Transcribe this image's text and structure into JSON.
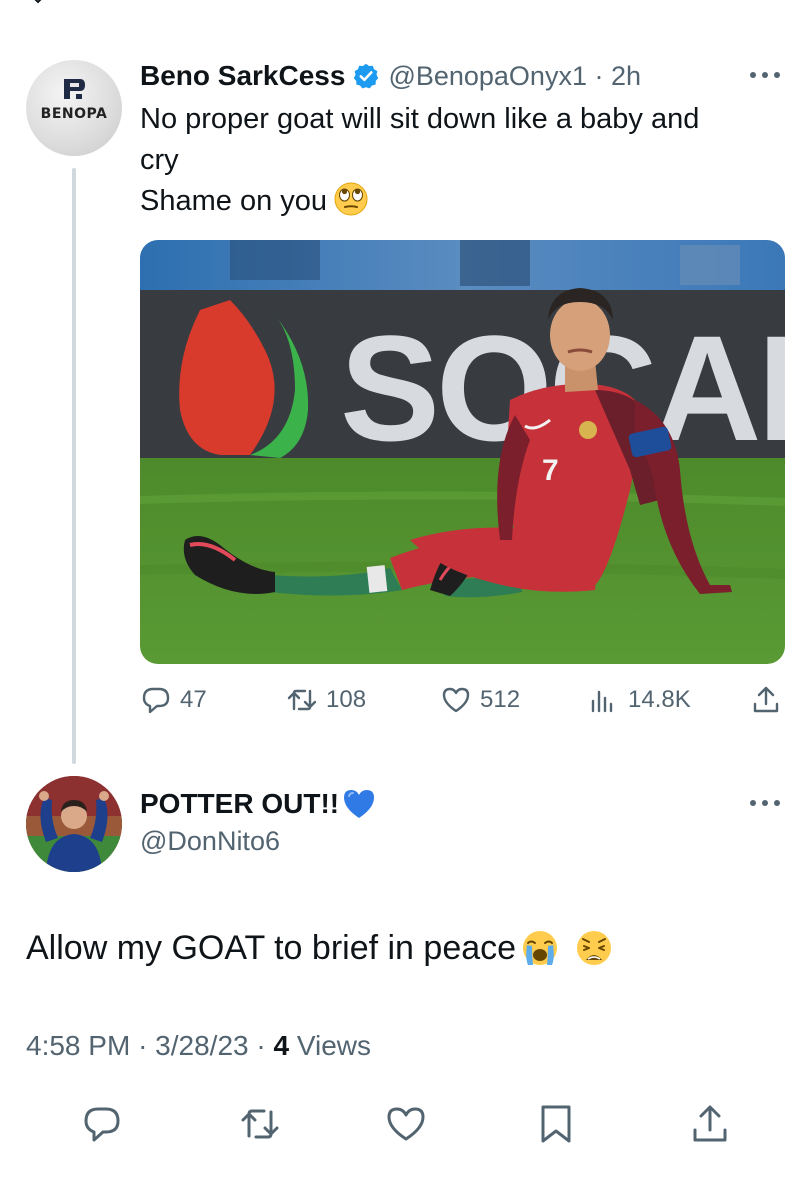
{
  "tweet": {
    "author": {
      "name": "Beno SarkCess",
      "handle": "@BenopaOnyx1",
      "time": "2h",
      "avatar_text": "BENOPA",
      "verified": true
    },
    "text_lines": [
      "No proper goat will sit down like a baby and",
      "cry",
      "Shame on you"
    ],
    "text_emoji": "face-with-rolling-eyes",
    "photo": {
      "banner_text": "SOCAR",
      "jersey_number": "7"
    },
    "stats": {
      "replies": "47",
      "retweets": "108",
      "likes": "512",
      "views": "14.8K"
    }
  },
  "reply": {
    "author": {
      "name": "POTTER OUT!!",
      "name_emoji": "blue-heart",
      "handle": "@DonNito6"
    },
    "text": "Allow my GOAT to brief in peace",
    "text_emojis": [
      "loudly-crying-face",
      "weary-face"
    ],
    "meta": {
      "time": "4:58 PM",
      "date": "3/28/23",
      "views_count": "4",
      "views_label": "Views",
      "separator": "·"
    }
  },
  "colors": {
    "text": "#0f1419",
    "secondary": "#536471",
    "verified": "#1d9bf0",
    "thread_line": "#cfd9de",
    "blue_heart": "#2f7ae5"
  }
}
